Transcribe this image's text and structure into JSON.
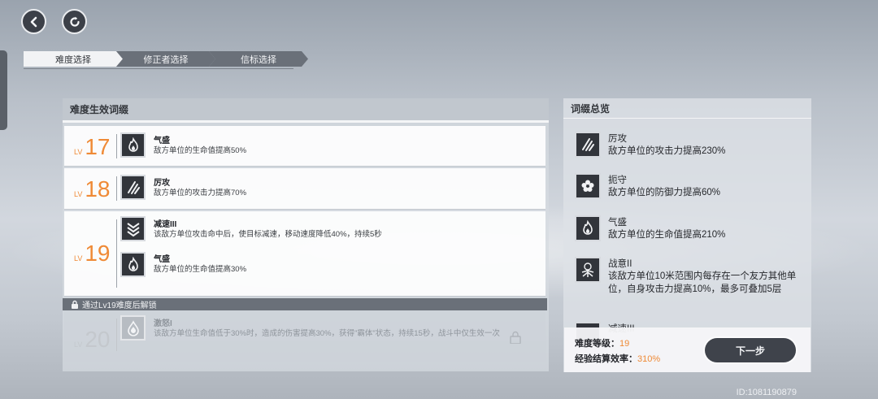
{
  "nav": {
    "back_icon": "arrow-left-icon",
    "refresh_icon": "refresh-icon"
  },
  "steps": [
    {
      "label": "难度选择",
      "active": true
    },
    {
      "label": "修正者选择",
      "active": false
    },
    {
      "label": "信标选择",
      "active": false
    }
  ],
  "difficulty_panel": {
    "title": "难度生效词缀",
    "level_prefix": "LV",
    "rows": [
      {
        "level": "17",
        "affixes": [
          {
            "name": "气盛",
            "desc": "敌方单位的生命值提高50%",
            "icon": "flame-icon"
          }
        ]
      },
      {
        "level": "18",
        "affixes": [
          {
            "name": "厉攻",
            "desc": "敌方单位的攻击力提高70%",
            "icon": "claw-slash-icon"
          }
        ]
      },
      {
        "level": "19",
        "affixes": [
          {
            "name": "减速III",
            "desc": "该敌方单位攻击命中后，使目标减速，移动速度降低40%，持续5秒",
            "icon": "chevrons-down-icon"
          },
          {
            "name": "气盛",
            "desc": "敌方单位的生命值提高30%",
            "icon": "flame-icon"
          }
        ]
      }
    ],
    "unlock_text": "通过Lv19难度后解锁",
    "locked_row": {
      "level": "20",
      "name": "激怒I",
      "desc": "该敌方单位生命值低于30%时，造成的伤害提高30%，获得\"霸体\"状态，持续15秒，战斗中仅生效一次",
      "icon": "drop-icon"
    }
  },
  "summary_panel": {
    "title": "词缀总览",
    "items": [
      {
        "name": "厉攻",
        "desc": "敌方单位的攻击力提高230%",
        "icon": "claw-slash-icon"
      },
      {
        "name": "扼守",
        "desc": "敌方单位的防御力提高60%",
        "icon": "flower-shield-icon"
      },
      {
        "name": "气盛",
        "desc": "敌方单位的生命值提高210%",
        "icon": "flame-icon"
      },
      {
        "name": "战意II",
        "desc": "该敌方单位10米范围内每存在一个友方其他单位，自身攻击力提高10%，最多可叠加5层",
        "icon": "battle-spirit-icon"
      },
      {
        "name": "减速III",
        "desc": "",
        "icon": "chevrons-down-icon"
      }
    ],
    "difficulty_label": "难度等级：",
    "difficulty_value": "19",
    "exp_label": "经验结算效率：",
    "exp_value": "310%",
    "next_button": "下一步"
  },
  "footer": {
    "id_text": "ID:1081190879"
  },
  "colors": {
    "accent": "#ef8a36",
    "dark": "#3f434b",
    "panel": "#d6dbe1"
  }
}
